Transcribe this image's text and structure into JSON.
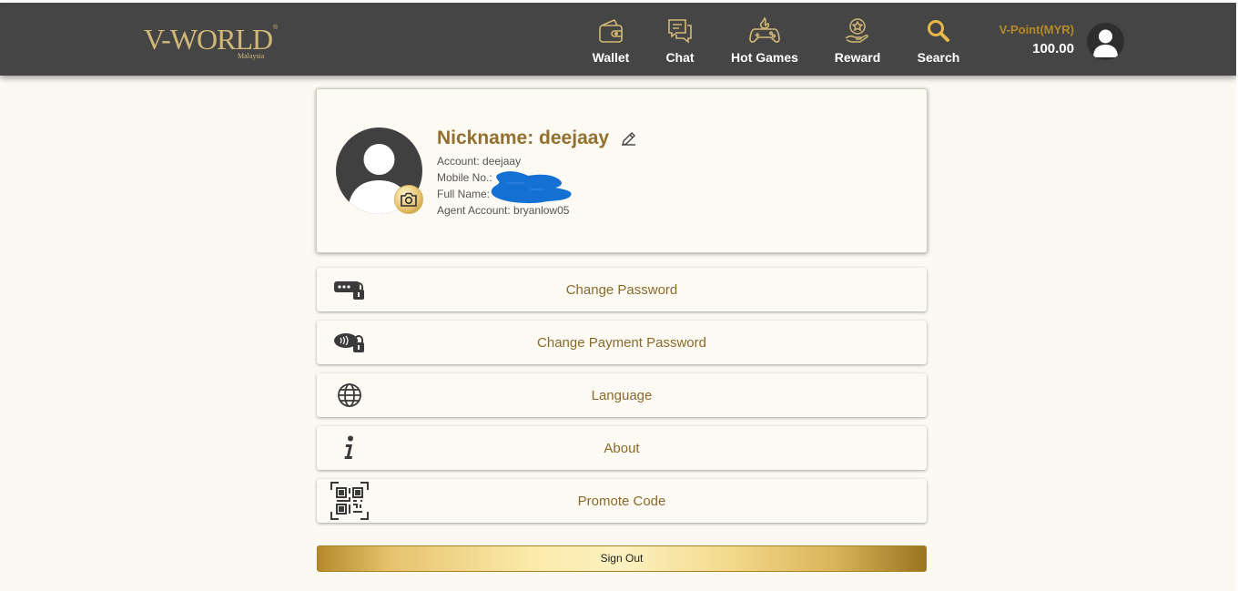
{
  "brand": {
    "name": "V-WORLD",
    "registered_mark": "®",
    "region": "Malaysia",
    "gold": "#d2b877"
  },
  "nav": [
    {
      "label": "Wallet",
      "icon": "wallet-icon"
    },
    {
      "label": "Chat",
      "icon": "chat-icon"
    },
    {
      "label": "Hot Games",
      "icon": "gamepad-icon"
    },
    {
      "label": "Reward",
      "icon": "reward-icon"
    },
    {
      "label": "Search",
      "icon": "search-icon"
    }
  ],
  "vpoint": {
    "label": "V-Point(MYR)",
    "value": "100.00"
  },
  "profile": {
    "nickname": "Nickname: deejaay",
    "account": "Account: deejaay",
    "mobile": "Mobile No.:",
    "full_name": "Full Name:",
    "agent": "Agent Account: bryanlow05"
  },
  "menu": [
    {
      "label": "Change Password",
      "icon": "password-lock-icon"
    },
    {
      "label": "Change Payment Password",
      "icon": "payment-lock-icon"
    },
    {
      "label": "Language",
      "icon": "globe-icon"
    },
    {
      "label": "About",
      "icon": "info-icon"
    },
    {
      "label": "Promote Code",
      "icon": "qr-code-icon"
    }
  ],
  "sign_out": "Sign Out",
  "colors": {
    "header_bg": "#454545",
    "page_bg": "#fcf9f2",
    "accent_text": "#94702e",
    "redaction": "#1470d2"
  }
}
